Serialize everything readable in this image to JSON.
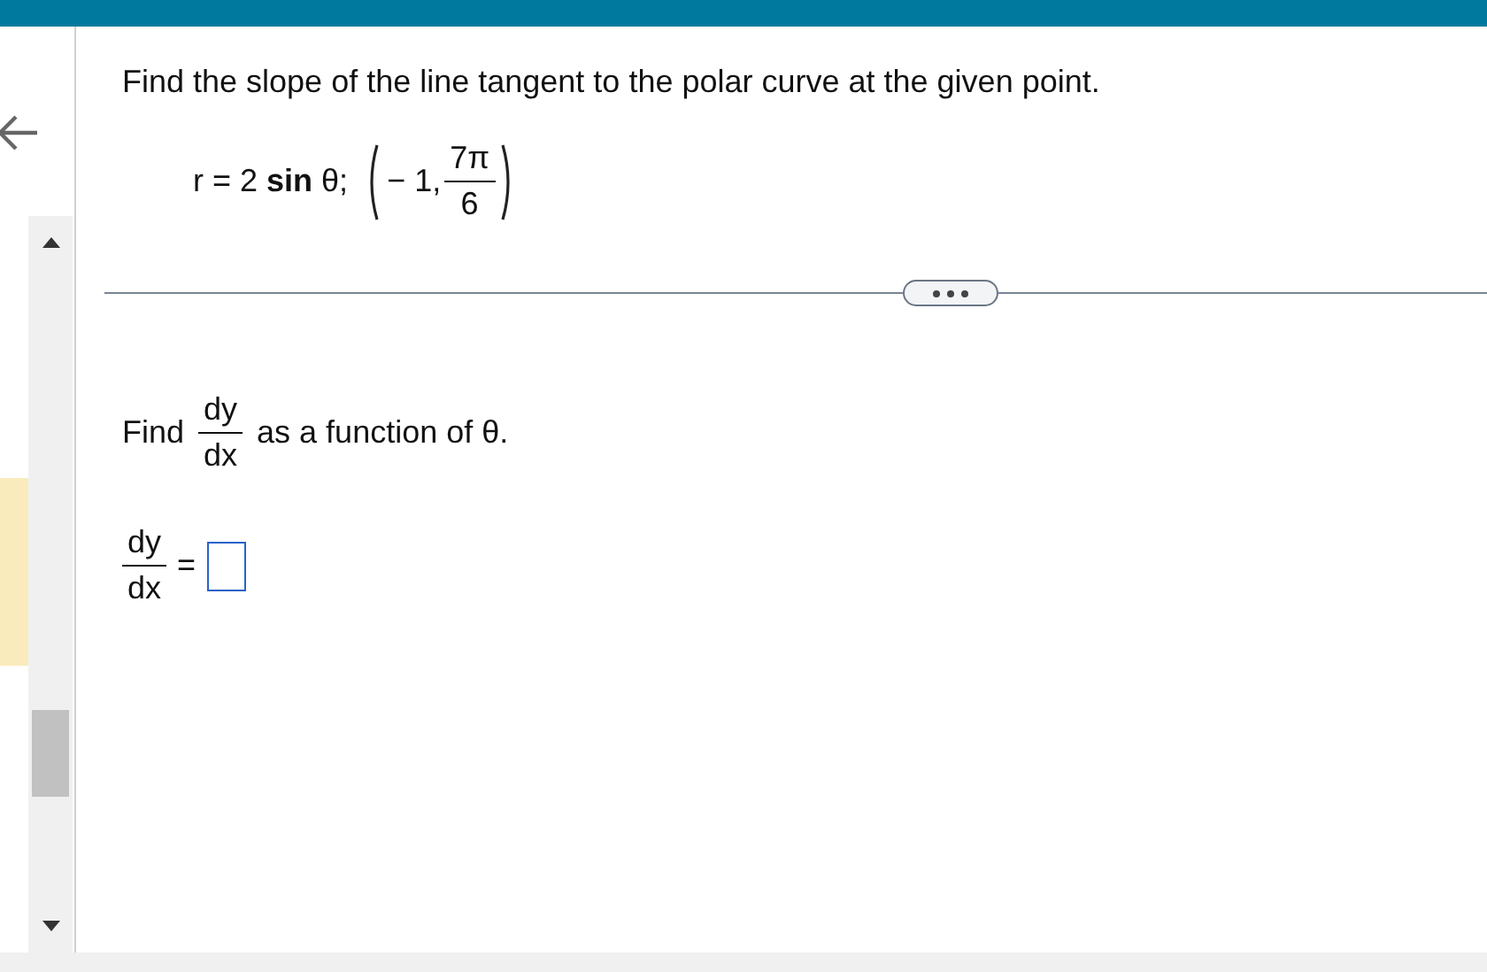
{
  "question": "Find the slope of the line tangent to the polar curve at the given point.",
  "equation": {
    "curve": "r = 2 **sin** θ;",
    "point_first": "− 1,",
    "point_numerator": "7π",
    "point_denominator": "6"
  },
  "prompt": {
    "before": "Find",
    "numerator": "dy",
    "denominator": "dx",
    "after": "as a function of θ."
  },
  "answer": {
    "numerator": "dy",
    "denominator": "dx",
    "equals": "="
  }
}
